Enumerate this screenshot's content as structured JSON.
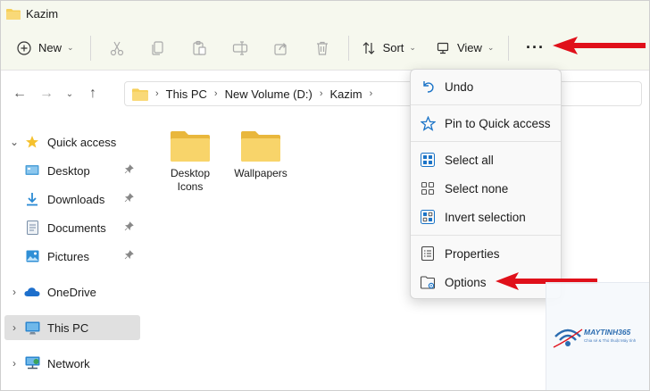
{
  "window": {
    "title": "Kazim"
  },
  "toolbar": {
    "new_label": "New",
    "sort_label": "Sort",
    "view_label": "View",
    "more_label": "···"
  },
  "address": {
    "crumbs": [
      "This PC",
      "New Volume (D:)",
      "Kazim"
    ]
  },
  "sidebar": {
    "items": [
      {
        "label": "Quick access"
      },
      {
        "label": "Desktop"
      },
      {
        "label": "Downloads"
      },
      {
        "label": "Documents"
      },
      {
        "label": "Pictures"
      },
      {
        "label": "OneDrive"
      },
      {
        "label": "This PC"
      },
      {
        "label": "Network"
      }
    ]
  },
  "content": {
    "folders": [
      {
        "label": "Desktop Icons"
      },
      {
        "label": "Wallpapers"
      }
    ]
  },
  "menu": {
    "items": [
      {
        "label": "Undo"
      },
      {
        "label": "Pin to Quick access"
      },
      {
        "label": "Select all"
      },
      {
        "label": "Select none"
      },
      {
        "label": "Invert selection"
      },
      {
        "label": "Properties"
      },
      {
        "label": "Options"
      }
    ]
  },
  "watermark": {
    "brand": "MAYTINH365",
    "tagline": "Chia sẻ & Thủ thuật Máy tính"
  },
  "colors": {
    "arrow": "#e0101a",
    "folder": "#f6cf59",
    "accent": "#1a73c7",
    "selected": "#e0e0e0"
  }
}
